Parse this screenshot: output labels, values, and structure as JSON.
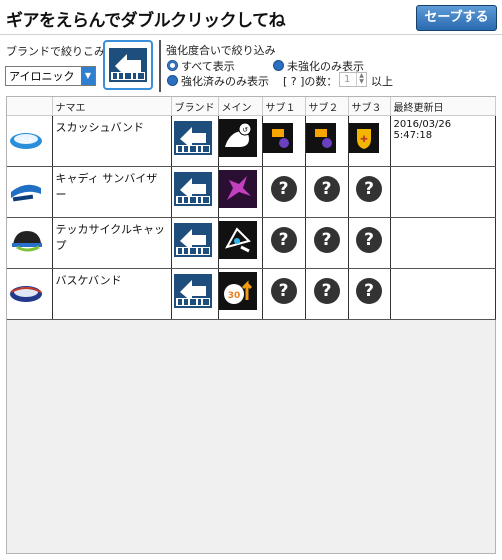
{
  "header": {
    "title": "ギアをえらんでダブルクリックしてね",
    "save_label": "セーブする"
  },
  "filters": {
    "brand_label": "ブランドで絞りこみ",
    "brand_selected": "アイロニック",
    "strength_label": "強化度合いで絞り込み",
    "radio_all": "すべて表示",
    "radio_unenhanced": "未強化のみ表示",
    "radio_enhanced": "強化済みのみ表示",
    "qcount_label": "[ ? ]の数：",
    "qcount_value": "1",
    "qcount_suffix": "以上"
  },
  "table": {
    "columns": [
      "",
      "ナマエ",
      "ブランド",
      "メイン",
      "サブ１",
      "サブ２",
      "サブ３",
      "最終更新日"
    ],
    "rows": [
      {
        "name": "スカッシュバンド",
        "date": "2016/03/26 5:47:18"
      },
      {
        "name": "キャディ サンバイザー",
        "date": ""
      },
      {
        "name": "テッカサイクルキャップ",
        "date": ""
      },
      {
        "name": "バスケバンド",
        "date": ""
      }
    ]
  },
  "colors": {
    "accent": "#2f7fd0",
    "save_button": "#3b7cc2"
  }
}
